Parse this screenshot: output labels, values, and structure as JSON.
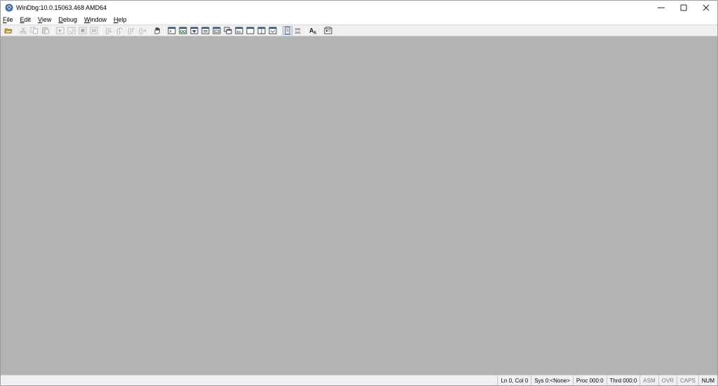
{
  "window": {
    "title": "WinDbg:10.0.15063.468 AMD64",
    "controls": {
      "minimize": "–",
      "maximize": "☐",
      "close": "✕"
    }
  },
  "menu": {
    "items": [
      {
        "first": "F",
        "rest": "ile"
      },
      {
        "first": "E",
        "rest": "dit"
      },
      {
        "first": "V",
        "rest": "iew"
      },
      {
        "first": "D",
        "rest": "ebug"
      },
      {
        "first": "W",
        "rest": "indow"
      },
      {
        "first": "H",
        "rest": "elp"
      }
    ]
  },
  "toolbar": {
    "icons": [
      "open-icon",
      "cut-icon",
      "copy-icon",
      "paste-icon",
      "go-icon",
      "restart-icon",
      "stop-icon",
      "break-icon",
      "step-into-icon",
      "step-over-icon",
      "step-out-icon",
      "run-to-cursor-icon",
      "breakpoint-hand-icon",
      "command-window-icon",
      "watch-window-icon",
      "locals-window-icon",
      "registers-window-icon",
      "memory-window-icon",
      "call-stack-icon",
      "disassembly-window-icon",
      "scratch-pad-icon",
      "processes-threads-icon",
      "source-mode-icon",
      "hex-mode-icon",
      "font-icon",
      "options-icon"
    ],
    "hex_label": "101\n101",
    "font_label": "AA"
  },
  "statusbar": {
    "cells": [
      "Ln 0, Col 0",
      "Sys 0:<None>",
      "Proc 000:0",
      "Thrd 000:0",
      "ASM",
      "OVR",
      "CAPS",
      "NUM"
    ]
  },
  "colors": {
    "workspace": "#b3b3b3",
    "chrome": "#f0f0f0",
    "titlebar": "#ffffff"
  }
}
